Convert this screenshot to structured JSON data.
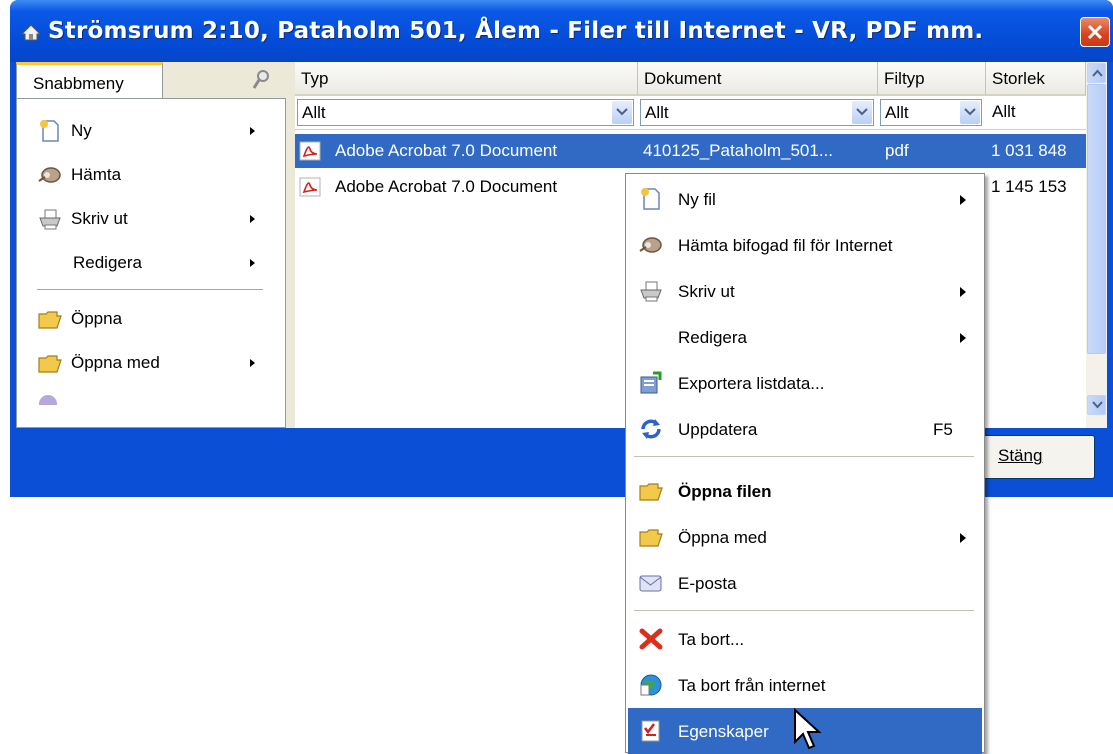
{
  "window": {
    "title": "Strömsrum 2:10, Pataholm 501, Ålem - Filer till Internet - VR, PDF mm.",
    "close_icon": "close-icon"
  },
  "left_panel": {
    "tab_label": "Snabbmeny",
    "items": [
      {
        "label": "Ny",
        "icon": "new-file-icon",
        "submenu": true
      },
      {
        "label": "Hämta",
        "icon": "fetch-icon",
        "submenu": false
      },
      {
        "label": "Skriv ut",
        "icon": "printer-icon",
        "submenu": true
      },
      {
        "label": "Redigera",
        "icon": "",
        "submenu": true
      },
      {
        "label": "Öppna",
        "icon": "folder-icon",
        "submenu": false
      },
      {
        "label": "Öppna med",
        "icon": "folder-icon",
        "submenu": true
      }
    ]
  },
  "list": {
    "columns": [
      "Typ",
      "Dokument",
      "Filtyp",
      "Storlek"
    ],
    "filters": [
      "Allt",
      "Allt",
      "Allt",
      "Allt"
    ],
    "rows": [
      {
        "typ": "Adobe Acrobat 7.0 Document",
        "dokument": "410125_Pataholm_501...",
        "filtyp": "pdf",
        "storlek": "1 031 848",
        "selected": true
      },
      {
        "typ": "Adobe Acrobat 7.0 Document",
        "dokument": "",
        "filtyp": "",
        "storlek": "1 145 153",
        "selected": false
      }
    ]
  },
  "buttons": {
    "close_label": "Stäng"
  },
  "context_menu": {
    "items": [
      {
        "label": "Ny fil",
        "icon": "new-file-icon",
        "submenu": true,
        "shortcut": ""
      },
      {
        "label": "Hämta bifogad fil för Internet",
        "icon": "fetch-icon",
        "submenu": false,
        "shortcut": ""
      },
      {
        "label": "Skriv ut",
        "icon": "printer-icon",
        "submenu": true,
        "shortcut": ""
      },
      {
        "label": "Redigera",
        "icon": "",
        "submenu": true,
        "shortcut": ""
      },
      {
        "label": "Exportera listdata...",
        "icon": "export-icon",
        "submenu": false,
        "shortcut": ""
      },
      {
        "label": "Uppdatera",
        "icon": "refresh-icon",
        "submenu": false,
        "shortcut": "F5"
      },
      {
        "label": "Öppna filen",
        "icon": "folder-icon",
        "submenu": false,
        "shortcut": "",
        "bold": true
      },
      {
        "label": "Öppna med",
        "icon": "folder-icon",
        "submenu": true,
        "shortcut": ""
      },
      {
        "label": "E-posta",
        "icon": "email-icon",
        "submenu": false,
        "shortcut": ""
      },
      {
        "label": "Ta bort...",
        "icon": "delete-icon",
        "submenu": false,
        "shortcut": ""
      },
      {
        "label": "Ta bort från internet",
        "icon": "globe-delete-icon",
        "submenu": false,
        "shortcut": ""
      },
      {
        "label": "Egenskaper",
        "icon": "properties-icon",
        "submenu": false,
        "shortcut": "",
        "highlighted": true
      }
    ]
  },
  "colors": {
    "title_blue": "#0a4fd6",
    "selection": "#316ac5",
    "close_red": "#d8431e"
  }
}
